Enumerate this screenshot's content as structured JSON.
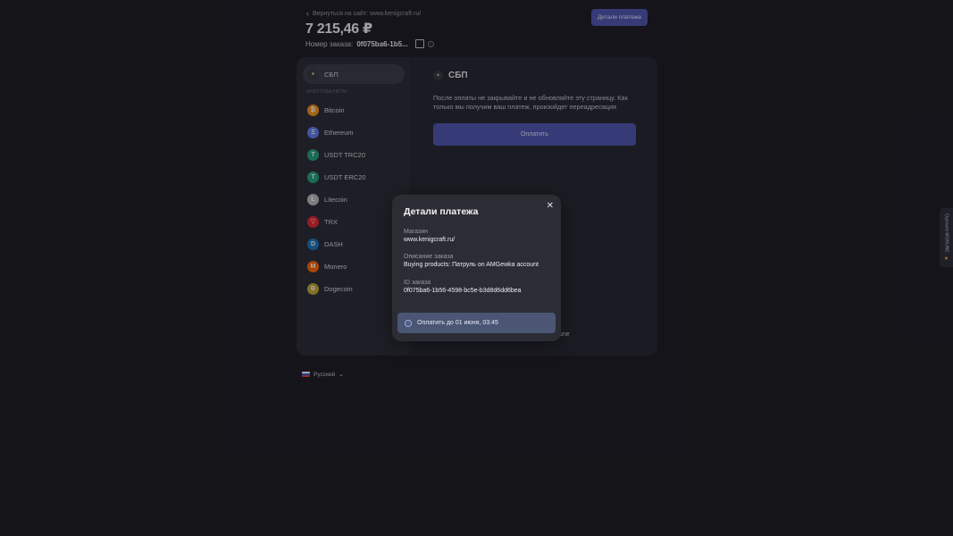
{
  "header": {
    "back_label": "Вернуться на сайт: www.kenigcraft.ru/",
    "amount": "7 215,46 ₽",
    "order_label": "Номер заказа:",
    "order_id_short": "0f075ba6-1b5...",
    "details_button": "Детали платежа"
  },
  "sidebar": {
    "active": {
      "label": "СБП",
      "icon": "sbp-icon"
    },
    "section_label": "КРИПТОВАЛЮТЫ",
    "items": [
      {
        "label": "Bitcoin",
        "icon": "bitcoin-icon",
        "color": "#f7931a",
        "glyph": "₿"
      },
      {
        "label": "Ethereum",
        "icon": "ethereum-icon",
        "color": "#627eea",
        "glyph": "Ξ"
      },
      {
        "label": "USDT TRC20",
        "icon": "tether-icon",
        "color": "#26a17b",
        "glyph": "T"
      },
      {
        "label": "USDT ERC20",
        "icon": "tether-icon",
        "color": "#26a17b",
        "glyph": "T"
      },
      {
        "label": "Litecoin",
        "icon": "litecoin-icon",
        "color": "#bebebe",
        "glyph": "Ł"
      },
      {
        "label": "TRX",
        "icon": "tron-icon",
        "color": "#e5262e",
        "glyph": "▽"
      },
      {
        "label": "DASH",
        "icon": "dash-icon",
        "color": "#1c75bc",
        "glyph": "D"
      },
      {
        "label": "Monero",
        "icon": "monero-icon",
        "color": "#ff6600",
        "glyph": "M"
      },
      {
        "label": "Dogecoin",
        "icon": "dogecoin-icon",
        "color": "#c2a633",
        "glyph": "Ð"
      }
    ]
  },
  "main": {
    "title": "СБП",
    "notice": "После оплаты не закрывайте и не обновляйте эту страницу. Как только мы получим ваш платеж, произойдет переадресация",
    "pay_button": "Оплатить",
    "footer_fragment": "une"
  },
  "language": {
    "label": "Русский"
  },
  "feedback": {
    "label": "Оцените MORUNE"
  },
  "modal": {
    "title": "Детали платежа",
    "fields": [
      {
        "label": "Магазин",
        "value": "www.kenigcraft.ru/"
      },
      {
        "label": "Описание заказа",
        "value": "Buying products: Патруль on AMGewka account"
      },
      {
        "label": "ID заказа",
        "value": "0f075ba6-1b56-4598-bc5e-b3d8d6dd6bea"
      }
    ],
    "deadline": "Оплатить до 01 июня, 03:45"
  }
}
